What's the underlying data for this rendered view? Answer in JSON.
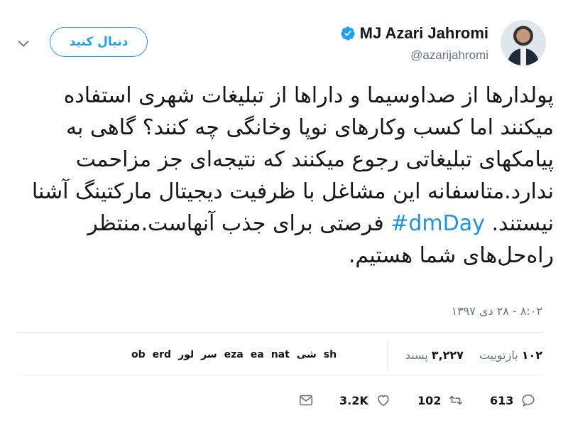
{
  "header": {
    "display_name": "MJ Azari Jahromi",
    "handle": "@azarijahromi",
    "follow_label": "دنبال کنید"
  },
  "tweet": {
    "text_before_hashtag": "پولدارها از صداوسیما و داراها از تبلیغات شهری استفاده میکنند اما کسب وکارهای نوپا وخانگی چه کنند؟ گاهی به پیامکهای تبلیغاتی رجوع میکنند که نتیجه‌ای جز مزاحمت ندارد.متاسفانه این مشاغل با ظرفیت دیجیتال مارکتینگ آشنا نیستند.",
    "hashtag": "#dmDay",
    "text_after_hashtag": "فرصتی برای جذب آنهاست.منتظر راه‌حل‌های شما هستیم.",
    "timestamp": "۸:۰۲ - ۲۸ دی ۱۳۹۷"
  },
  "stats": {
    "retweets_count": "۱۰۲",
    "retweets_label": "بازتوییت",
    "likes_count": "۳,۲۲۷",
    "likes_label": "پسند"
  },
  "likers": [
    "sh",
    "شی",
    "nat",
    "ea",
    "eza",
    "سر",
    "لور",
    "erd",
    "ob"
  ],
  "actions": {
    "replies": "613",
    "retweets": "102",
    "likes": "3.2K"
  },
  "colors": {
    "accent": "#1da1f2",
    "hashtag": "#1b95e0",
    "muted": "#657786",
    "text": "#14171a"
  }
}
